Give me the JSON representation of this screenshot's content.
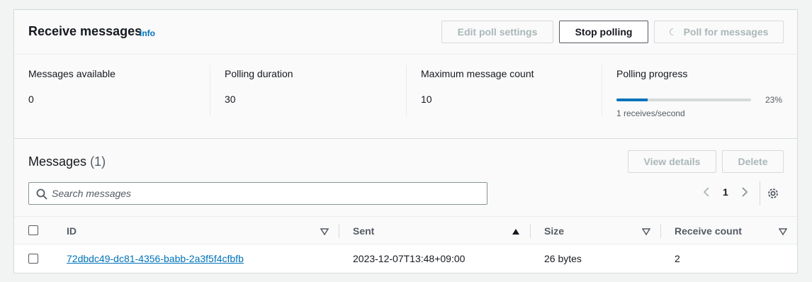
{
  "header": {
    "title": "Receive messages",
    "info_label": "Info",
    "buttons": {
      "edit_poll_settings": "Edit poll settings",
      "stop_polling": "Stop polling",
      "poll_for_messages": "Poll for messages"
    }
  },
  "stats": {
    "messages_available": {
      "label": "Messages available",
      "value": "0"
    },
    "polling_duration": {
      "label": "Polling duration",
      "value": "30"
    },
    "maximum_message_count": {
      "label": "Maximum message count",
      "value": "10"
    },
    "polling_progress": {
      "label": "Polling progress",
      "percent": 23,
      "percent_label": "23%",
      "description": "1 receives/second"
    }
  },
  "messages": {
    "title": "Messages",
    "count_label": "(1)",
    "buttons": {
      "view_details": "View details",
      "delete": "Delete"
    },
    "search_placeholder": "Search messages",
    "pagination": {
      "current_page": "1"
    },
    "columns": {
      "id": "ID",
      "sent": "Sent",
      "size": "Size",
      "receive_count": "Receive count"
    },
    "rows": [
      {
        "id": "72dbdc49-dc81-4356-babb-2a3f5f4cfbfb",
        "sent": "2023-12-07T13:48+09:00",
        "size": "26 bytes",
        "receive_count": "2"
      }
    ]
  },
  "icons": {
    "search": "search-icon",
    "settings": "gear-icon",
    "sort_desc": "caret-down-outline-icon",
    "sort_asc": "caret-up-filled-icon",
    "prev": "chevron-left-icon",
    "next": "chevron-right-icon",
    "spinner": "spinner-icon"
  },
  "colors": {
    "link": "#0073bb",
    "progress": "#0073bb",
    "border": "#d5dbdb"
  }
}
